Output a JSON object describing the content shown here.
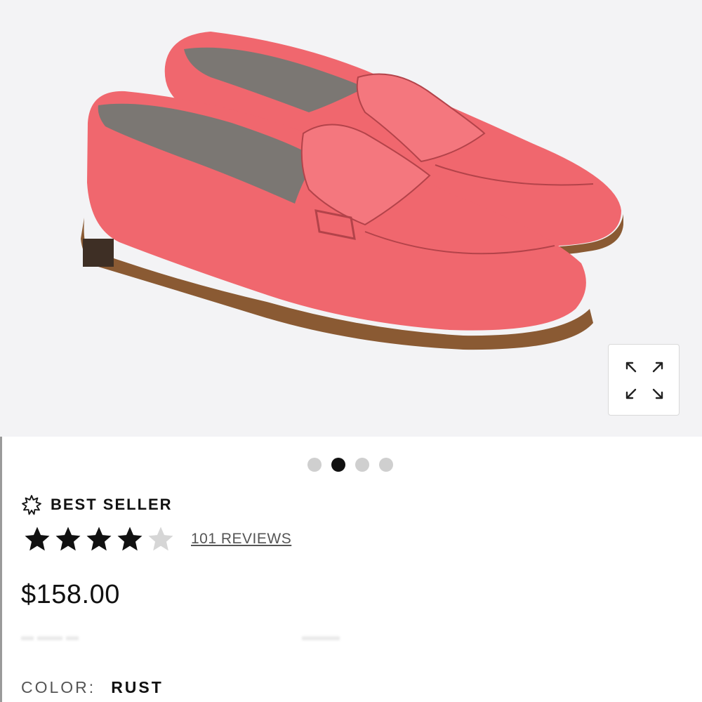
{
  "product": {
    "image_alt": "Pink penny loafers",
    "carousel": {
      "count": 4,
      "active_index": 1
    },
    "badge": {
      "icon": "starburst-icon",
      "label": "BEST SELLER"
    },
    "rating": {
      "value": 4,
      "max": 5,
      "reviews_label": "101 REVIEWS"
    },
    "price": "$158.00",
    "color": {
      "label": "COLOR:",
      "value": "RUST"
    }
  },
  "colors": {
    "hero_bg": "#f3f3f5",
    "shoe": "#f0676e",
    "sole": "#8a5a33",
    "active_dot": "#111111",
    "inactive_dot": "#cfcfcf"
  }
}
